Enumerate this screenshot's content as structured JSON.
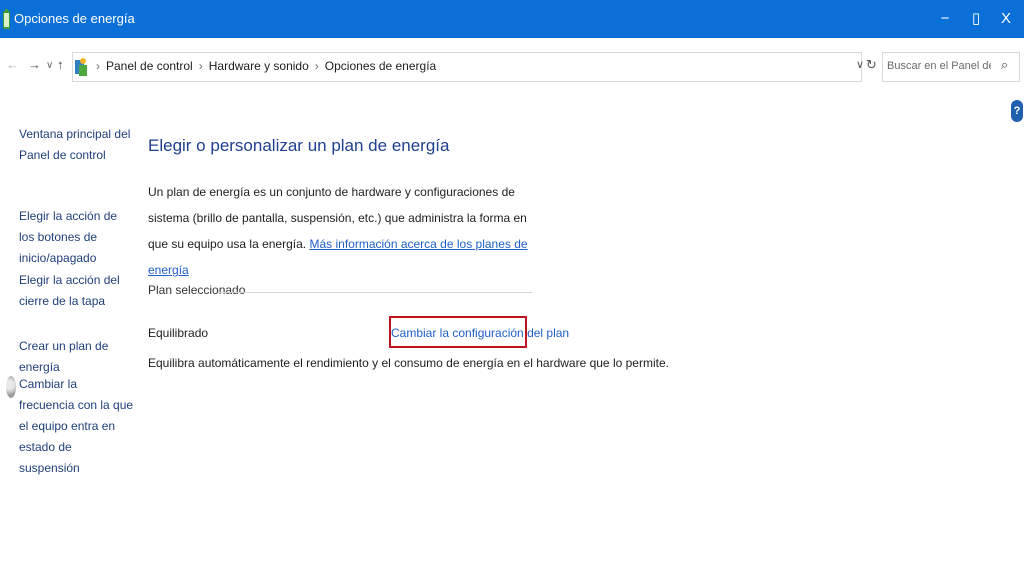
{
  "window": {
    "title": "Opciones de energía",
    "minimize_label": "−",
    "maximize_label": "▯",
    "close_label": "X",
    "accent_color": "#0a6fd6"
  },
  "nav": {
    "back_label": "←",
    "forward_label": "→",
    "history_label": "∨",
    "up_label": "↑",
    "breadcrumbs": [
      "Panel de control",
      "Hardware y sonido",
      "Opciones de energía"
    ],
    "breadcrumb_separator": "›",
    "dropdown_label": "∨",
    "refresh_label": "↻",
    "search_placeholder": "Buscar en el Panel de control",
    "search_icon_glyph": "⌕"
  },
  "help": {
    "label": "?"
  },
  "left_pane": {
    "links": [
      "Ventana principal del Panel de control",
      "Elegir la acción de los botones de inicio/apagado",
      "Elegir la acción del cierre de la tapa",
      "Crear un plan de energía",
      "Cambiar la frecuencia con la que el equipo entra en estado de suspensión"
    ]
  },
  "main": {
    "title": "Elegir o personalizar un plan de energía",
    "description": "Un plan de energía es un conjunto de hardware y configuraciones de sistema (brillo de pantalla, suspensión, etc.) que administra la forma en que su equipo usa la energía.",
    "more_info_link": "Más información acerca de los planes de energía",
    "section_label": "Plan seleccionado",
    "plan_name": "Equilibrado",
    "change_plan_link": "Cambiar la configuración del plan",
    "plan_description": "Equilibra automáticamente el rendimiento y el consumo de energía en el hardware que lo permite.",
    "highlight_color": "#c1121f",
    "link_color": "#1f5fc8"
  }
}
